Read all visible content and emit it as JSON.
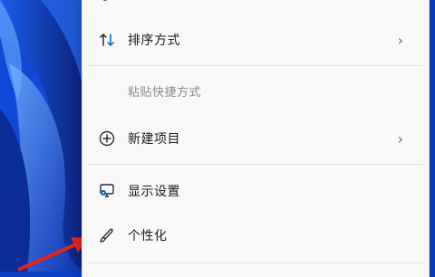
{
  "menu": {
    "items": [
      {
        "label": "排序方式",
        "icon": "sort-icon",
        "has_submenu": true,
        "chevron": "›"
      },
      {
        "label": "粘贴快捷方式",
        "disabled": true
      },
      {
        "label": "新建项目",
        "icon": "add-circle-icon",
        "has_submenu": true,
        "chevron": "›"
      },
      {
        "label": "显示设置",
        "icon": "display-settings-icon"
      },
      {
        "label": "个性化",
        "icon": "brush-icon"
      }
    ]
  },
  "colors": {
    "menu_bg": "#f8f8f8",
    "text": "#1b1b1b",
    "disabled_text": "#8a8a8a",
    "wallpaper_blue": "#0a3fc4",
    "annotation_arrow": "#e0261b"
  }
}
